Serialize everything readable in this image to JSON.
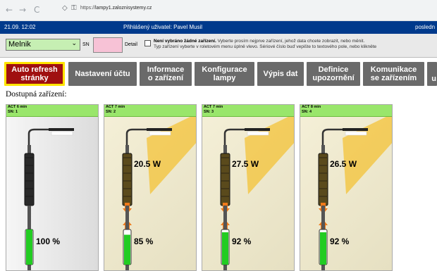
{
  "browser": {
    "nav_back": "←",
    "nav_forward": "→",
    "nav_reload": "C",
    "url_prefix": "https://",
    "url_domain": "lampy1.zaloznisystemy.cz"
  },
  "status": {
    "datetime": "21.09. 12:02",
    "user_label": "Přihlášený uživatel: Pavel Musil",
    "right_text": "posledn"
  },
  "filter": {
    "location_value": "Melnik",
    "sn_label": "SN",
    "sn_value": "",
    "detail_label": "Detail",
    "detail_checked": false,
    "notice_bold": "Není vybráno žádné zařízení.",
    "notice_line1": " Vyberte prosím nejprve zařízení, jehož data chcete zobrazit, nebo měnit.",
    "notice_line2": "Typ zařízení vyberte v roletovém menu úplně vlevo. Sériové číslo buď vepište to textového pole, nebo klikněte"
  },
  "menu": [
    {
      "label": "Auto refresh\nstránky",
      "active": true
    },
    {
      "label": "Nastavení účtu"
    },
    {
      "label": "Informace\no zařízení"
    },
    {
      "label": "Konfigurace\nlampy"
    },
    {
      "label": "Výpis dat"
    },
    {
      "label": "Definice\nupozornění"
    },
    {
      "label": "Komunikace\nse zařízením"
    },
    {
      "label": "u"
    }
  ],
  "section_title": "Dostupná zařízení:",
  "devices": [
    {
      "act": "ACT 6 min",
      "sn": "SN: 1",
      "power": "",
      "battery": "100 %",
      "battery_level": 100,
      "lit": false
    },
    {
      "act": "ACT 7 min",
      "sn": "SN: 2",
      "power": "20.5 W",
      "battery": "85 %",
      "battery_level": 85,
      "lit": true
    },
    {
      "act": "ACT 7 min",
      "sn": "SN: 3",
      "power": "27.5 W",
      "battery": "92 %",
      "battery_level": 92,
      "lit": true
    },
    {
      "act": "ACT 8 min",
      "sn": "SN: 4",
      "power": "26.5 W",
      "battery": "92 %",
      "battery_level": 92,
      "lit": true
    }
  ],
  "colors": {
    "status_bar": "#003a8c",
    "menu_button": "#6a6a6a",
    "refresh_button": "#a01010",
    "refresh_border": "#ffe400",
    "card_header": "#99e66b",
    "battery": "#22cc22",
    "light_beam": "#f5b400",
    "arrow": "#f07a1a"
  }
}
